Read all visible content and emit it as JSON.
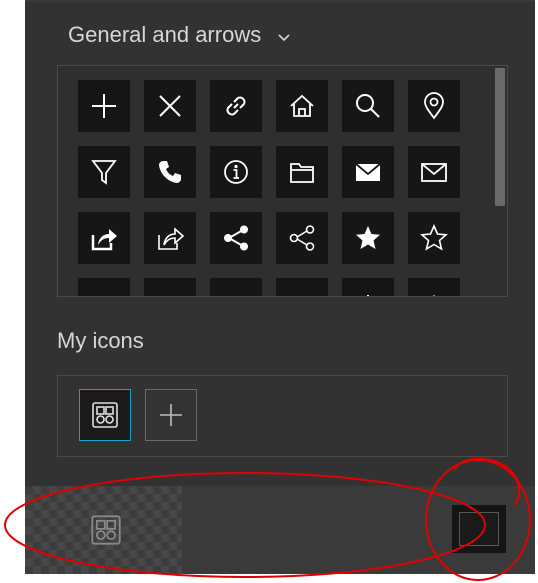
{
  "category": {
    "label": "General and arrows"
  },
  "icon_grid": {
    "rows": [
      [
        "plus",
        "close",
        "link",
        "home",
        "search",
        "location-pin"
      ],
      [
        "filter",
        "phone",
        "info",
        "folder",
        "mail-filled",
        "mail-outline"
      ],
      [
        "share-out-filled",
        "share-out-outline",
        "share-filled",
        "share-outline",
        "star-filled",
        "star-outline"
      ]
    ]
  },
  "my_icons": {
    "title": "My icons"
  },
  "colors": {
    "accent": "#1fa0c8",
    "panel": "#323232",
    "cell": "#161616",
    "annotation": "#e00000"
  }
}
